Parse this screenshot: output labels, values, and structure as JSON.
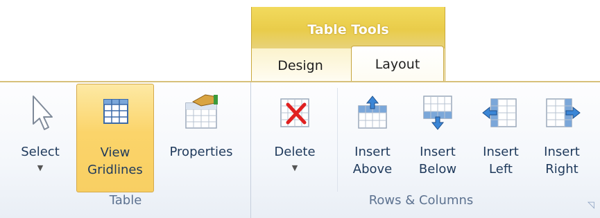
{
  "contextual": {
    "title": "Table Tools"
  },
  "tabs": [
    {
      "label": "Design",
      "selected": false
    },
    {
      "label": "Layout",
      "selected": true
    }
  ],
  "groups": {
    "table": {
      "label": "Table",
      "buttons": {
        "select": {
          "label": "Select",
          "has_dropdown": true
        },
        "view_gridlines": {
          "line1": "View",
          "line2": "Gridlines",
          "active": true
        },
        "properties": {
          "label": "Properties"
        }
      }
    },
    "rows_columns": {
      "label": "Rows & Columns",
      "buttons": {
        "delete": {
          "label": "Delete",
          "has_dropdown": true
        },
        "insert_above": {
          "line1": "Insert",
          "line2": "Above"
        },
        "insert_below": {
          "line1": "Insert",
          "line2": "Below"
        },
        "insert_left": {
          "line1": "Insert",
          "line2": "Left"
        },
        "insert_right": {
          "line1": "Insert",
          "line2": "Right"
        }
      }
    }
  },
  "colors": {
    "accent_gold": "#e9cc4a",
    "active_button": "#fbd46a",
    "text": "#1e395b"
  }
}
